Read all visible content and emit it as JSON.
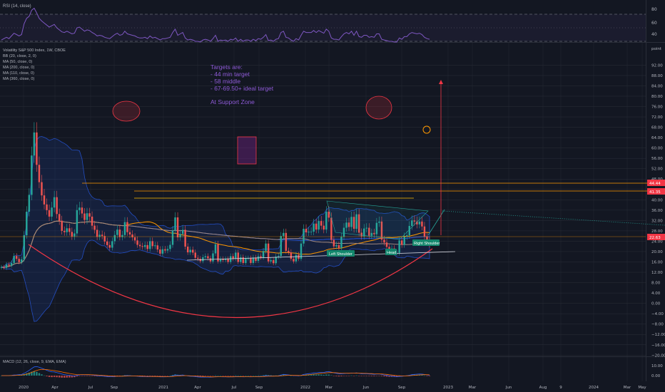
{
  "colors": {
    "background": "#131722",
    "up_candle": "#26a69a",
    "down_candle": "#ef5350",
    "rsi_line": "#7e57c2",
    "bb_fill": "#2962ff",
    "annotation_text": "#8e5ad6",
    "orange_line": "#ff9800",
    "arc": "#f23645",
    "label_teal": "#13876c",
    "price_label_red": "#f23645"
  },
  "panes": {
    "rsi": {
      "title": "RSI (14, close)",
      "levels": [
        80,
        60,
        40
      ]
    },
    "main": {
      "legend": [
        "Volatility S&P 500 Index, 1W, CBOE",
        "BB (20, close, 2, 0)",
        "MA (50, close, 0)",
        "MA (200, close, 0)",
        "MA (110, close, 0)",
        "MA (360, close, 0)"
      ],
      "axis_unit": "point",
      "price_ticks": [
        "92.00",
        "88.00",
        "84.00",
        "80.00",
        "76.00",
        "72.00",
        "68.00",
        "64.00",
        "60.00",
        "56.00",
        "52.00",
        "48.00",
        "44.00",
        "40.00",
        "36.00",
        "32.00",
        "28.00",
        "24.00",
        "20.00",
        "16.00",
        "12.00",
        "8.00",
        "4.00",
        "0.00",
        "−4.00",
        "−8.00",
        "−12.00",
        "−16.00",
        "−20.00"
      ],
      "price_labels": [
        "44.44",
        "41.35",
        "22.63"
      ]
    },
    "macd": {
      "title": "MACD (12, 26, close, 9, EMA, EMA)",
      "ticks": [
        "10.00",
        "0.00"
      ]
    }
  },
  "x_axis": [
    "2020",
    "Apr",
    "Jul",
    "Sep",
    "2021",
    "Apr",
    "Jul",
    "Sep",
    "2022",
    "Mar",
    "Jun",
    "Sep",
    "2023",
    "Mar",
    "Jun",
    "Aug",
    "9",
    "2024",
    "Mar",
    "May"
  ],
  "annotations": {
    "targets_text": [
      "Targets are:",
      "- 44 min target",
      "- 58 middle",
      "- 67-69.50+ ideal target",
      "",
      "At Support Zone"
    ],
    "labels": [
      "Left Shoulder",
      "Head",
      "Right Shoulder"
    ]
  },
  "chart_data": {
    "type": "candlestick",
    "title": "Volatility S&P 500 Index, 1W, CBOE",
    "ylabel": "point",
    "ylim": [
      -22,
      94
    ],
    "series": [
      {
        "name": "VIX",
        "close": [
          14.0,
          13.7,
          15.0,
          14.6,
          15.6,
          18.3,
          17.2,
          15.9,
          17.0,
          26.3,
          35.4,
          41.9,
          57.1,
          66.0,
          53.5,
          46.8,
          41.7,
          38.2,
          36.0,
          33.5,
          37.0,
          41.0,
          34.5,
          31.9,
          28.0,
          27.5,
          29.0,
          27.6,
          25.8,
          27.0,
          36.0,
          37.0,
          34.7,
          32.2,
          34.8,
          33.5,
          30.0,
          28.4,
          25.7,
          26.5,
          26.0,
          23.9,
          22.5,
          21.5,
          24.0,
          26.4,
          28.5,
          25.6,
          26.4,
          31.4,
          27.5,
          26.6,
          25.5,
          24.3,
          22.6,
          22.1,
          21.8,
          22.5,
          21.0,
          24.0,
          22.1,
          22.4,
          20.8,
          19.2,
          20.9,
          20.4,
          21.0,
          22.6,
          28.2,
          33.2,
          25.5,
          26.8,
          28.4,
          21.9,
          19.7,
          20.7,
          19.6,
          17.6,
          17.2,
          16.3,
          17.8,
          18.2,
          17.4,
          16.2,
          19.3,
          22.8,
          16.2,
          17.1,
          16.7,
          17.1,
          16.0,
          18.2,
          17.2,
          19.6,
          16.0,
          17.8,
          15.6,
          17.4,
          17.4,
          15.6,
          17.7,
          16.4,
          18.2,
          17.7,
          20.2,
          23.1,
          16.2,
          16.7,
          15.5,
          18.0,
          18.3,
          26.0,
          27.2,
          20.3,
          19.7,
          17.2,
          16.2,
          18.7,
          17.2,
          23.1,
          28.8,
          27.4,
          27.7,
          27.7,
          30.8,
          28.5,
          31.8,
          30.0,
          28.5,
          35.4,
          33.1,
          24.5,
          22.0,
          22.5,
          21.4,
          25.7,
          29.2,
          31.2,
          29.5,
          33.4,
          28.8,
          34.4,
          27.3,
          25.9,
          28.9,
          29.2,
          26.1,
          27.2,
          26.7,
          31.1,
          31.6,
          24.6,
          23.5,
          21.8,
          20.8,
          21.2,
          19.5,
          19.5,
          24.3,
          22.6,
          25.8,
          26.3,
          29.9,
          32.0,
          31.6,
          30.5,
          31.6,
          29.7,
          25.8,
          24.1,
          22.6
        ]
      },
      {
        "name": "RSI",
        "values": [
          42,
          44,
          46,
          44,
          48,
          52,
          50,
          48,
          50,
          66,
          74,
          77,
          86,
          89,
          82,
          74,
          70,
          67,
          64,
          61,
          63,
          65,
          60,
          57,
          54,
          53,
          55,
          53,
          51,
          52,
          60,
          61,
          58,
          55,
          57,
          56,
          53,
          51,
          48,
          49,
          48,
          46,
          45,
          44,
          47,
          50,
          52,
          49,
          50,
          55,
          51,
          50,
          49,
          48,
          46,
          45,
          45,
          46,
          44,
          48,
          45,
          46,
          44,
          42,
          44,
          44,
          45,
          46,
          53,
          58,
          49,
          51,
          53,
          45,
          42,
          43,
          42,
          40,
          40,
          39,
          42,
          43,
          42,
          40,
          44,
          49,
          40,
          42,
          41,
          42,
          40,
          43,
          42,
          45,
          40,
          43,
          40,
          42,
          42,
          40,
          43,
          41,
          44,
          43,
          46,
          50,
          41,
          42,
          40,
          43,
          44,
          53,
          55,
          46,
          45,
          42,
          40,
          44,
          42,
          49,
          55,
          53,
          53,
          53,
          56,
          53,
          56,
          54,
          52,
          58,
          55,
          45,
          43,
          43,
          42,
          47,
          51,
          53,
          51,
          55,
          49,
          55,
          47,
          46,
          49,
          49,
          46,
          47,
          46,
          51,
          51,
          43,
          42,
          41,
          40,
          40,
          39,
          39,
          45,
          43,
          47,
          47,
          51,
          53,
          52,
          51,
          52,
          50,
          46,
          44,
          43
        ]
      },
      {
        "name": "MACD",
        "values": [
          0,
          0,
          0.1,
          0.1,
          0.3,
          0.6,
          0.8,
          1.0,
          1.2,
          2.5,
          4.0,
          5.6,
          7.6,
          9.4,
          9.7,
          9.0,
          8.0,
          6.9,
          5.8,
          4.7,
          4.1,
          3.9,
          3.2,
          2.5,
          1.7,
          1.1,
          0.7,
          0.3,
          -0.1,
          -0.3,
          0.3,
          0.8,
          1.0,
          0.9,
          1.0,
          0.9,
          0.6,
          0.3,
          -0.1,
          -0.3,
          -0.5,
          -0.8,
          -1.0,
          -1.2,
          -1.2,
          -1.0,
          -0.7,
          -0.7,
          -0.6,
          -0.1,
          0.0,
          -0.1,
          -0.3,
          -0.5,
          -0.7,
          -0.9,
          -1.1,
          -1.1,
          -1.2,
          -1.0,
          -1.1,
          -1.0,
          -1.1,
          -1.3,
          -1.3,
          -1.3,
          -1.2,
          -1.0,
          -0.3,
          0.6,
          0.5,
          0.5,
          0.6,
          0.1,
          -0.4,
          -0.6,
          -0.8,
          -1.1,
          -1.4,
          -1.6,
          -1.6,
          -1.6,
          -1.6,
          -1.7,
          -1.5,
          -1.0,
          -1.2,
          -1.2,
          -1.3,
          -1.3,
          -1.4,
          -1.3,
          -1.3,
          -1.0,
          -1.1,
          -1.1,
          -1.3,
          -1.2,
          -1.2,
          -1.3,
          -1.2,
          -1.2,
          -1.0,
          -1.0,
          -0.6,
          0.0,
          -0.2,
          -0.3,
          -0.5,
          -0.4,
          -0.3,
          0.6,
          1.3,
          1.0,
          0.8,
          0.4,
          0.0,
          0.0,
          -0.2,
          0.3,
          1.2,
          1.7,
          2.1,
          2.4,
          2.9,
          3.0,
          3.4,
          3.5,
          3.5,
          4.1,
          4.3,
          3.7,
          3.0,
          2.5,
          2.0,
          2.0,
          2.2,
          2.5,
          2.5,
          2.8,
          2.6,
          2.9,
          2.5,
          2.1,
          2.1,
          2.1,
          1.8,
          1.6,
          1.4,
          1.6,
          1.8,
          1.2,
          0.7,
          0.2,
          -0.3,
          -0.6,
          -0.9,
          -1.2,
          -0.9,
          -0.8,
          -0.4,
          -0.1,
          0.4,
          1.0,
          1.3,
          1.5,
          1.7,
          1.6,
          1.2,
          0.8,
          0.4
        ]
      }
    ]
  }
}
